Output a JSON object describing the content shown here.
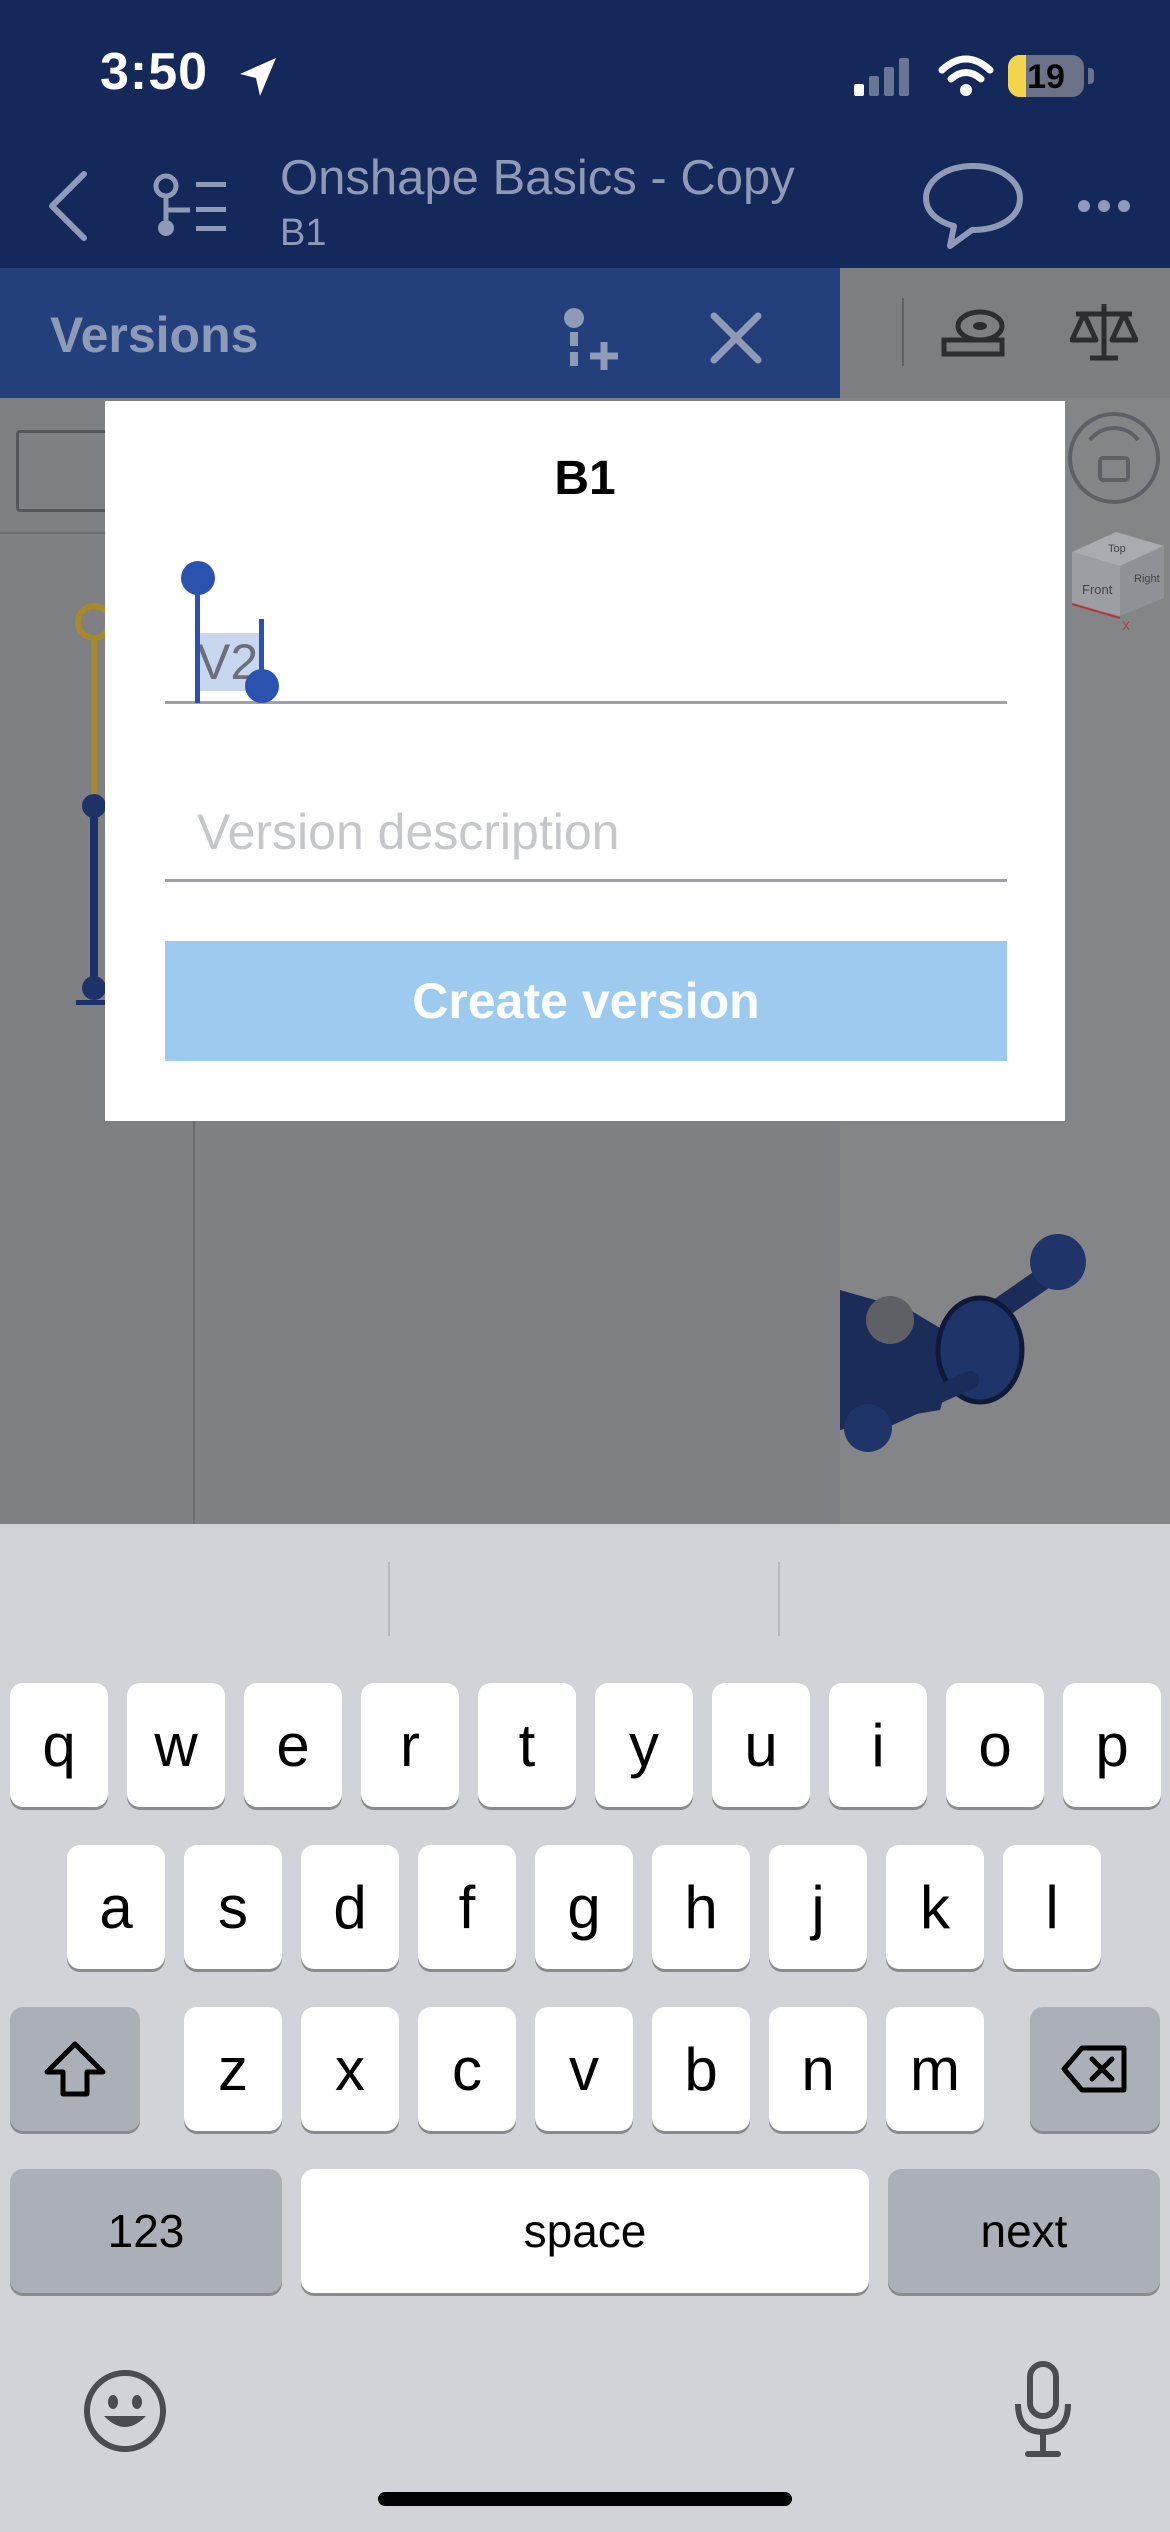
{
  "status_bar": {
    "time": "3:50",
    "battery": "19"
  },
  "nav": {
    "title": "Onshape Basics - Copy",
    "subtitle": "B1"
  },
  "versions_panel": {
    "title": "Versions"
  },
  "dialog": {
    "title": "B1",
    "version_name_value": "V2",
    "description_placeholder": "Version description",
    "create_button_label": "Create version"
  },
  "viewcube": {
    "front_label": "Front",
    "top_label": "Top",
    "right_label": "Right",
    "axis_x": "X"
  },
  "keyboard": {
    "row1": [
      "q",
      "w",
      "e",
      "r",
      "t",
      "y",
      "u",
      "i",
      "o",
      "p"
    ],
    "row2": [
      "a",
      "s",
      "d",
      "f",
      "g",
      "h",
      "j",
      "k",
      "l"
    ],
    "row3": [
      "z",
      "x",
      "c",
      "v",
      "b",
      "n",
      "m"
    ],
    "numbers_label": "123",
    "space_label": "space",
    "return_label": "next"
  },
  "colors": {
    "header_bg": "#14295a",
    "accent": "#2c52b0",
    "button_disabled": "#9ccbef"
  }
}
